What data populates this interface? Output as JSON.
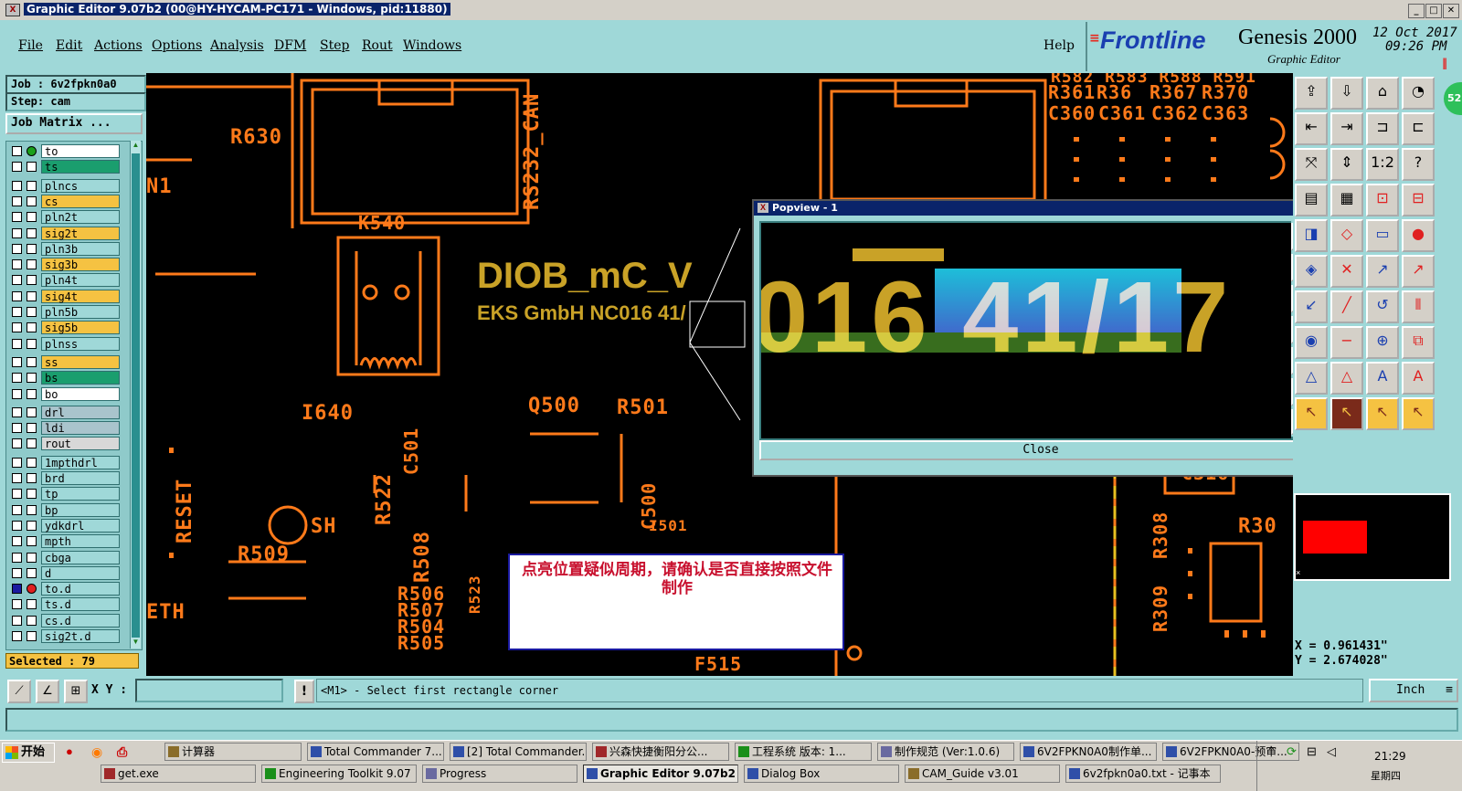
{
  "window": {
    "title": "Graphic Editor 9.07b2 (00@HY-HYCAM-PC171 - Windows, pid:11880)",
    "buttons": [
      "_",
      "□",
      "✕"
    ]
  },
  "menu": {
    "items": [
      "File",
      "Edit",
      "Actions",
      "Options",
      "Analysis",
      "DFM",
      "Step",
      "Rout",
      "Windows"
    ],
    "help": "Help"
  },
  "brand": {
    "logo": "Frontline",
    "product": "Genesis 2000",
    "subtitle": "Graphic Editor",
    "date": "12 Oct 2017",
    "time": "09:26 PM"
  },
  "left": {
    "job": "Job : 6v2fpkn0a0",
    "step": "Step: cam",
    "job_matrix": "Job Matrix ...",
    "selected": "Selected : 79",
    "layers": [
      {
        "name": "to",
        "bg": "#ffffff"
      },
      {
        "name": "ts",
        "bg": "#1a9e6e"
      },
      {
        "name": "plncs",
        "bg": "#9fd8d8"
      },
      {
        "name": "cs",
        "bg": "#f5c242"
      },
      {
        "name": "pln2t",
        "bg": "#9fd8d8"
      },
      {
        "name": "sig2t",
        "bg": "#f5c242"
      },
      {
        "name": "pln3b",
        "bg": "#9fd8d8"
      },
      {
        "name": "sig3b",
        "bg": "#f5c242"
      },
      {
        "name": "pln4t",
        "bg": "#9fd8d8"
      },
      {
        "name": "sig4t",
        "bg": "#f5c242"
      },
      {
        "name": "pln5b",
        "bg": "#9fd8d8"
      },
      {
        "name": "sig5b",
        "bg": "#f5c242"
      },
      {
        "name": "plnss",
        "bg": "#9fd8d8"
      },
      {
        "name": "ss",
        "bg": "#f5c242"
      },
      {
        "name": "bs",
        "bg": "#1a9e6e"
      },
      {
        "name": "bo",
        "bg": "#ffffff"
      },
      {
        "name": "drl",
        "bg": "#a9c4cc"
      },
      {
        "name": "ldi",
        "bg": "#a9c4cc"
      },
      {
        "name": "rout",
        "bg": "#d8d8d8"
      },
      {
        "name": "1mpthdrl",
        "bg": "#9fd8d8"
      },
      {
        "name": "brd",
        "bg": "#9fd8d8"
      },
      {
        "name": "tp",
        "bg": "#9fd8d8"
      },
      {
        "name": "bp",
        "bg": "#9fd8d8"
      },
      {
        "name": "ydkdrl",
        "bg": "#9fd8d8"
      },
      {
        "name": "mpth",
        "bg": "#9fd8d8"
      },
      {
        "name": "cbga",
        "bg": "#9fd8d8"
      },
      {
        "name": "d",
        "bg": "#9fd8d8"
      },
      {
        "name": "to.d",
        "bg": "#9fd8d8"
      },
      {
        "name": "ts.d",
        "bg": "#9fd8d8"
      },
      {
        "name": "cs.d",
        "bg": "#9fd8d8"
      },
      {
        "name": "sig2t.d",
        "bg": "#9fd8d8"
      }
    ]
  },
  "canvas": {
    "labels": {
      "r630": "R630",
      "rs232": "RS232_CAN",
      "k540": "K540",
      "n1": "N1",
      "i640": "I640",
      "q500": "Q500",
      "r501": "R501",
      "c501": "C501",
      "c500": "C500",
      "i501": "I501",
      "r522": "R522",
      "reset": "RESET",
      "sh": "SH",
      "r509": "R509",
      "r508": "R508",
      "r506": "R506",
      "r507": "R507",
      "r504": "R504",
      "r505": "R505",
      "r523": "R523",
      "eth": "ETH",
      "f515": "F515",
      "c316": "C316",
      "r308": "R308",
      "r309": "R309",
      "r30x": "R30",
      "r361": "R361",
      "r364": "R36",
      "r367": "R367",
      "r370": "R370",
      "c360": "C360",
      "c361": "C361",
      "c362": "C362",
      "c363": "C363",
      "r582": "R582 R583 R588 R591",
      "diob": "DIOB_mC_V",
      "eks": "EKS GmbH  NC016 41/"
    },
    "note": "点亮位置疑似周期，请确认是否直接按照文件制作"
  },
  "popview": {
    "title": "Popview - 1",
    "text": "016 41/17",
    "close": "Close"
  },
  "coords": {
    "x": "X = 0.961431\"",
    "y": "Y = 2.674028\"",
    "unit": "Inch"
  },
  "command": {
    "xy_label": "X Y :",
    "xy_value": "",
    "prompt": "<M1> - Select first rectangle corner"
  },
  "taskbar": {
    "start": "开始",
    "row1": [
      "计算器",
      "Total Commander 7....",
      "[2] Total Commander...",
      "兴森快捷衡阳分公...",
      "工程系统  版本: 1...",
      "制作规范 (Ver:1.0.6)",
      "6V2FPKN0A0制作单...",
      "6V2FPKN0A0-预审..."
    ],
    "row2": [
      "get.exe",
      "Engineering Toolkit 9.07",
      "Progress",
      "Graphic Editor 9.07b2",
      "Dialog Box",
      "CAM_Guide v3.01",
      "6v2fpkn0a0.txt - 记事本"
    ],
    "clock": "21:29",
    "weekday": "星期四"
  }
}
